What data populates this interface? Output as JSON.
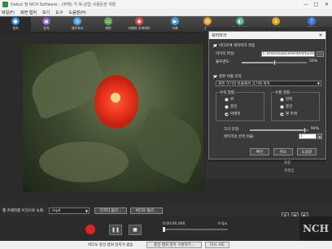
{
  "window": {
    "title": "Debut 정 NCH Software - (무제) 거 복·상업 사용돈관 위원",
    "minimize": "—",
    "maximize": "□",
    "close": "✕"
  },
  "menu": [
    "파일(F)",
    "화면 캡처",
    "보기",
    "도구",
    "도움말(H)"
  ],
  "toolbar": {
    "items": [
      {
        "label": "캡처",
        "icon": "capture-icon",
        "color": "#3a8fd8",
        "glyph": "●"
      },
      {
        "label": "장치",
        "icon": "device-icon",
        "color": "#8a5bc8",
        "glyph": "▣"
      },
      {
        "label": "네트워크",
        "icon": "network-icon",
        "color": "#4aa0d8",
        "glyph": "◎"
      },
      {
        "label": "화면",
        "icon": "screen-icon",
        "color": "#6aa84f",
        "glyph": "▭"
      },
      {
        "label": "카메라 오버레이",
        "icon": "camera-overlay-icon",
        "color": "#d84a4a",
        "glyph": "◉"
      },
      {
        "label": "녹화",
        "icon": "record-icon",
        "color": "#3aa0d8",
        "glyph": "▶"
      },
      {
        "label": "옵션",
        "icon": "options-icon",
        "color": "#e0a030",
        "glyph": "⚙"
      },
      {
        "label": "모드로 옵션",
        "icon": "mode-options-icon",
        "color": "#4ab0a0",
        "glyph": "◐"
      },
      {
        "label": "온라인 구매",
        "icon": "buy-online-icon",
        "color": "#d8a020",
        "glyph": "$"
      },
      {
        "label": "도움말",
        "icon": "help-icon",
        "color": "#3a7ad8",
        "glyph": "?"
      }
    ]
  },
  "dialog": {
    "title": "워터마크",
    "close": "✕",
    "watermark_checkbox": "비디오에 워터마크 적용",
    "image_file_label": "이미지 파일:",
    "image_file_value": "C:\\Users\\Document\\Pictures\\",
    "browse": "...",
    "opacity_label": "불투명도:",
    "opacity_value": "50%",
    "opacity_fraction": 0.5,
    "caption_checkbox": "원본 비율 유지",
    "fit_select": "화면 크기의 비율에서 크기와 위치",
    "vertical_group": "수직 정렬",
    "vertical_options": [
      "위",
      "중앙",
      "아래쪽"
    ],
    "vertical_selected": 2,
    "horizontal_group": "수평 정렬",
    "horizontal_options": [
      "왼쪽",
      "중앙",
      "맨 아래"
    ],
    "horizontal_selected": 2,
    "size_label": "크기 조정:",
    "size_value": "94%",
    "size_fraction": 0.94,
    "margin_label": "테두리의 반격 비율:",
    "margin_value": "1",
    "ok": "확인",
    "cancel": "취소",
    "help": "도움말"
  },
  "side_labels": {
    "volume": "볼륨",
    "frame": "프레임"
  },
  "bottom": {
    "format_label": "웹 카메라를 이것으로 녹화:",
    "format_value": ".mp4",
    "encoder_button": "인코더 옵션...",
    "video_button": "비디오 옵션..."
  },
  "controls": {
    "timecode": "0:00:00.000",
    "fps": "0 fps",
    "pause": "❚❚",
    "stop": "■",
    "logo": "NCH"
  },
  "status": {
    "message": "비디오 중앙 캡처 장치가 없음",
    "button1": "중앙 캡처 장치 구성하기...",
    "button2": "다시 시도"
  }
}
